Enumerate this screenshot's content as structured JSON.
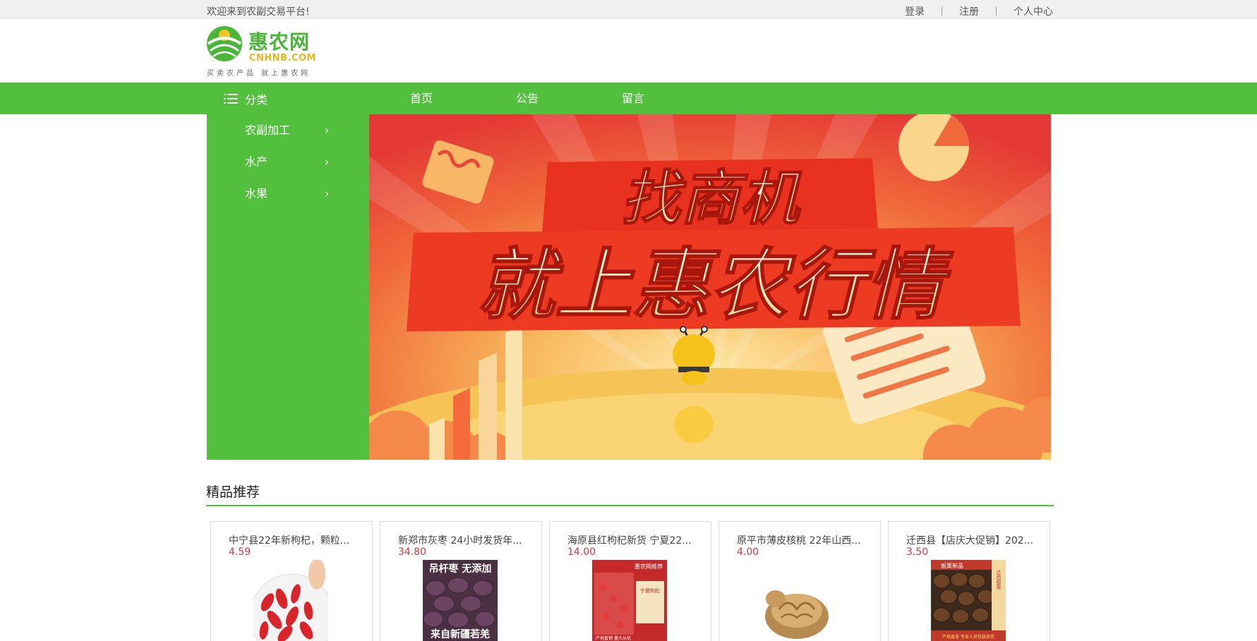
{
  "topbar": {
    "welcome": "欢迎来到农副交易平台!",
    "login": "登录",
    "register": "注册",
    "user_center": "个人中心"
  },
  "logo": {
    "name": "惠农网",
    "domain": "CNHNB.COM",
    "slogan": "买卖农产品 就上惠农网"
  },
  "nav": {
    "category_label": "分类",
    "items": [
      "首页",
      "公告",
      "留言"
    ]
  },
  "categories": [
    "农副加工",
    "水产",
    "水果"
  ],
  "banner": {
    "line1": "找商机",
    "line2": "就上惠农行情"
  },
  "section": {
    "title": "精品推荐"
  },
  "products": [
    {
      "name": "中宁县22年新枸杞，颗粒...",
      "price": "4.59",
      "image": "goji-berries"
    },
    {
      "name": "新郑市灰枣 24小时发货年...",
      "price": "34.80",
      "image": "jujube-dates",
      "image_text": [
        "吊杆枣 无添加",
        "来自新疆若羌"
      ]
    },
    {
      "name": "海原县红枸杞新货 宁夏22...",
      "price": "14.00",
      "image": "goji-poster",
      "image_text": [
        "惠农网推荐",
        "宁夏枸杞",
        "产地直销 量大从优"
      ]
    },
    {
      "name": "原平市薄皮核桃 22年山西...",
      "price": "4.00",
      "image": "walnuts"
    },
    {
      "name": "迁西县【店庆大促销】202...",
      "price": "3.50",
      "image": "chestnuts",
      "image_text": [
        "板栗新品",
        "迁西板栗",
        "产地直发 专业人员包装发货"
      ]
    }
  ],
  "colors": {
    "brand_green": "#52bf3d",
    "price_red": "#d9363e",
    "logo_yellow": "#e6b820"
  }
}
